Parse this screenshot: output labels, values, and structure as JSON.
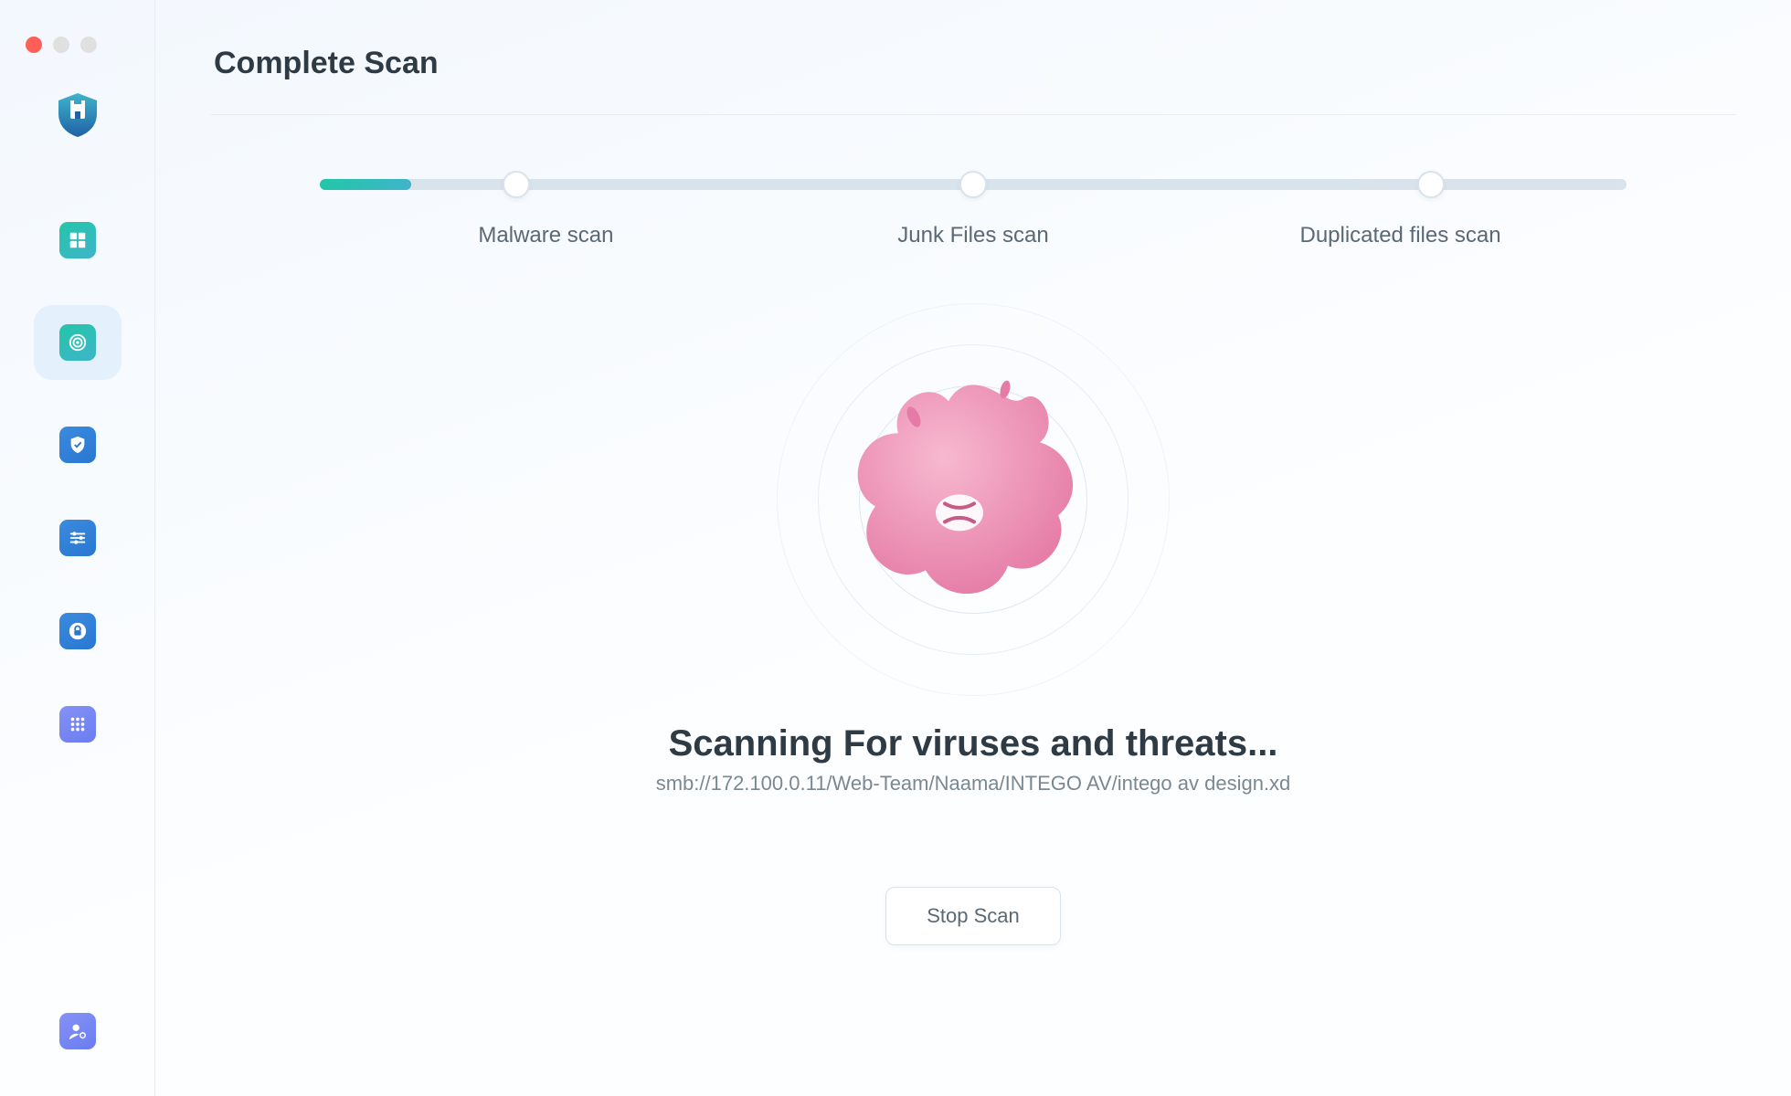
{
  "window": {
    "title": "Complete Scan"
  },
  "sidebar": {
    "items": [
      {
        "name": "logo",
        "icon": "castle-shield"
      },
      {
        "name": "dashboard",
        "icon": "grid"
      },
      {
        "name": "scan",
        "icon": "target",
        "selected": true
      },
      {
        "name": "protection",
        "icon": "shield-check"
      },
      {
        "name": "settings",
        "icon": "sliders"
      },
      {
        "name": "privacy",
        "icon": "lock-circle"
      },
      {
        "name": "apps",
        "icon": "apps-grid"
      }
    ],
    "bottom": {
      "name": "account",
      "icon": "user-cog"
    }
  },
  "stepper": {
    "steps": [
      {
        "label": "Malware scan"
      },
      {
        "label": "Junk Files scan"
      },
      {
        "label": "Duplicated files scan"
      }
    ],
    "progress_percent": 7
  },
  "status": {
    "title": "Scanning For viruses and threats...",
    "current_path": "smb://172.100.0.11/Web-Team/Naama/INTEGO AV/intego av design.xd"
  },
  "actions": {
    "stop_label": "Stop Scan"
  }
}
